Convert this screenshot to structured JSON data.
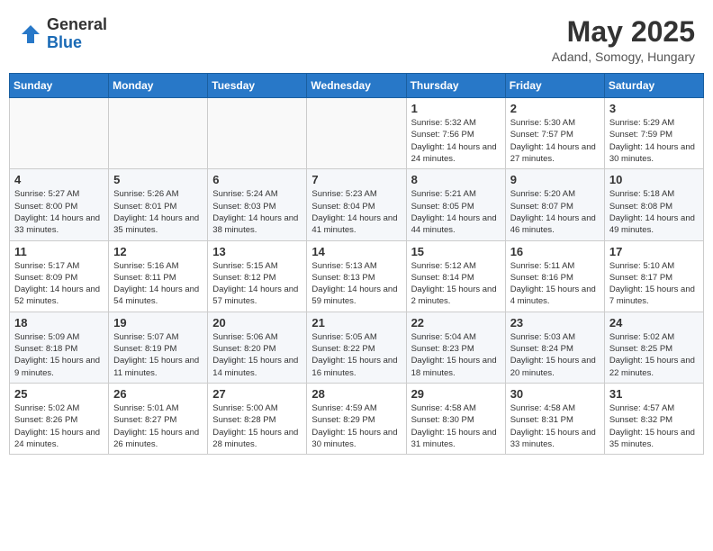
{
  "header": {
    "logo_line1": "General",
    "logo_line2": "Blue",
    "month_year": "May 2025",
    "location": "Adand, Somogy, Hungary"
  },
  "weekdays": [
    "Sunday",
    "Monday",
    "Tuesday",
    "Wednesday",
    "Thursday",
    "Friday",
    "Saturday"
  ],
  "weeks": [
    [
      {
        "day": "",
        "info": ""
      },
      {
        "day": "",
        "info": ""
      },
      {
        "day": "",
        "info": ""
      },
      {
        "day": "",
        "info": ""
      },
      {
        "day": "1",
        "info": "Sunrise: 5:32 AM\nSunset: 7:56 PM\nDaylight: 14 hours and 24 minutes."
      },
      {
        "day": "2",
        "info": "Sunrise: 5:30 AM\nSunset: 7:57 PM\nDaylight: 14 hours and 27 minutes."
      },
      {
        "day": "3",
        "info": "Sunrise: 5:29 AM\nSunset: 7:59 PM\nDaylight: 14 hours and 30 minutes."
      }
    ],
    [
      {
        "day": "4",
        "info": "Sunrise: 5:27 AM\nSunset: 8:00 PM\nDaylight: 14 hours and 33 minutes."
      },
      {
        "day": "5",
        "info": "Sunrise: 5:26 AM\nSunset: 8:01 PM\nDaylight: 14 hours and 35 minutes."
      },
      {
        "day": "6",
        "info": "Sunrise: 5:24 AM\nSunset: 8:03 PM\nDaylight: 14 hours and 38 minutes."
      },
      {
        "day": "7",
        "info": "Sunrise: 5:23 AM\nSunset: 8:04 PM\nDaylight: 14 hours and 41 minutes."
      },
      {
        "day": "8",
        "info": "Sunrise: 5:21 AM\nSunset: 8:05 PM\nDaylight: 14 hours and 44 minutes."
      },
      {
        "day": "9",
        "info": "Sunrise: 5:20 AM\nSunset: 8:07 PM\nDaylight: 14 hours and 46 minutes."
      },
      {
        "day": "10",
        "info": "Sunrise: 5:18 AM\nSunset: 8:08 PM\nDaylight: 14 hours and 49 minutes."
      }
    ],
    [
      {
        "day": "11",
        "info": "Sunrise: 5:17 AM\nSunset: 8:09 PM\nDaylight: 14 hours and 52 minutes."
      },
      {
        "day": "12",
        "info": "Sunrise: 5:16 AM\nSunset: 8:11 PM\nDaylight: 14 hours and 54 minutes."
      },
      {
        "day": "13",
        "info": "Sunrise: 5:15 AM\nSunset: 8:12 PM\nDaylight: 14 hours and 57 minutes."
      },
      {
        "day": "14",
        "info": "Sunrise: 5:13 AM\nSunset: 8:13 PM\nDaylight: 14 hours and 59 minutes."
      },
      {
        "day": "15",
        "info": "Sunrise: 5:12 AM\nSunset: 8:14 PM\nDaylight: 15 hours and 2 minutes."
      },
      {
        "day": "16",
        "info": "Sunrise: 5:11 AM\nSunset: 8:16 PM\nDaylight: 15 hours and 4 minutes."
      },
      {
        "day": "17",
        "info": "Sunrise: 5:10 AM\nSunset: 8:17 PM\nDaylight: 15 hours and 7 minutes."
      }
    ],
    [
      {
        "day": "18",
        "info": "Sunrise: 5:09 AM\nSunset: 8:18 PM\nDaylight: 15 hours and 9 minutes."
      },
      {
        "day": "19",
        "info": "Sunrise: 5:07 AM\nSunset: 8:19 PM\nDaylight: 15 hours and 11 minutes."
      },
      {
        "day": "20",
        "info": "Sunrise: 5:06 AM\nSunset: 8:20 PM\nDaylight: 15 hours and 14 minutes."
      },
      {
        "day": "21",
        "info": "Sunrise: 5:05 AM\nSunset: 8:22 PM\nDaylight: 15 hours and 16 minutes."
      },
      {
        "day": "22",
        "info": "Sunrise: 5:04 AM\nSunset: 8:23 PM\nDaylight: 15 hours and 18 minutes."
      },
      {
        "day": "23",
        "info": "Sunrise: 5:03 AM\nSunset: 8:24 PM\nDaylight: 15 hours and 20 minutes."
      },
      {
        "day": "24",
        "info": "Sunrise: 5:02 AM\nSunset: 8:25 PM\nDaylight: 15 hours and 22 minutes."
      }
    ],
    [
      {
        "day": "25",
        "info": "Sunrise: 5:02 AM\nSunset: 8:26 PM\nDaylight: 15 hours and 24 minutes."
      },
      {
        "day": "26",
        "info": "Sunrise: 5:01 AM\nSunset: 8:27 PM\nDaylight: 15 hours and 26 minutes."
      },
      {
        "day": "27",
        "info": "Sunrise: 5:00 AM\nSunset: 8:28 PM\nDaylight: 15 hours and 28 minutes."
      },
      {
        "day": "28",
        "info": "Sunrise: 4:59 AM\nSunset: 8:29 PM\nDaylight: 15 hours and 30 minutes."
      },
      {
        "day": "29",
        "info": "Sunrise: 4:58 AM\nSunset: 8:30 PM\nDaylight: 15 hours and 31 minutes."
      },
      {
        "day": "30",
        "info": "Sunrise: 4:58 AM\nSunset: 8:31 PM\nDaylight: 15 hours and 33 minutes."
      },
      {
        "day": "31",
        "info": "Sunrise: 4:57 AM\nSunset: 8:32 PM\nDaylight: 15 hours and 35 minutes."
      }
    ]
  ]
}
